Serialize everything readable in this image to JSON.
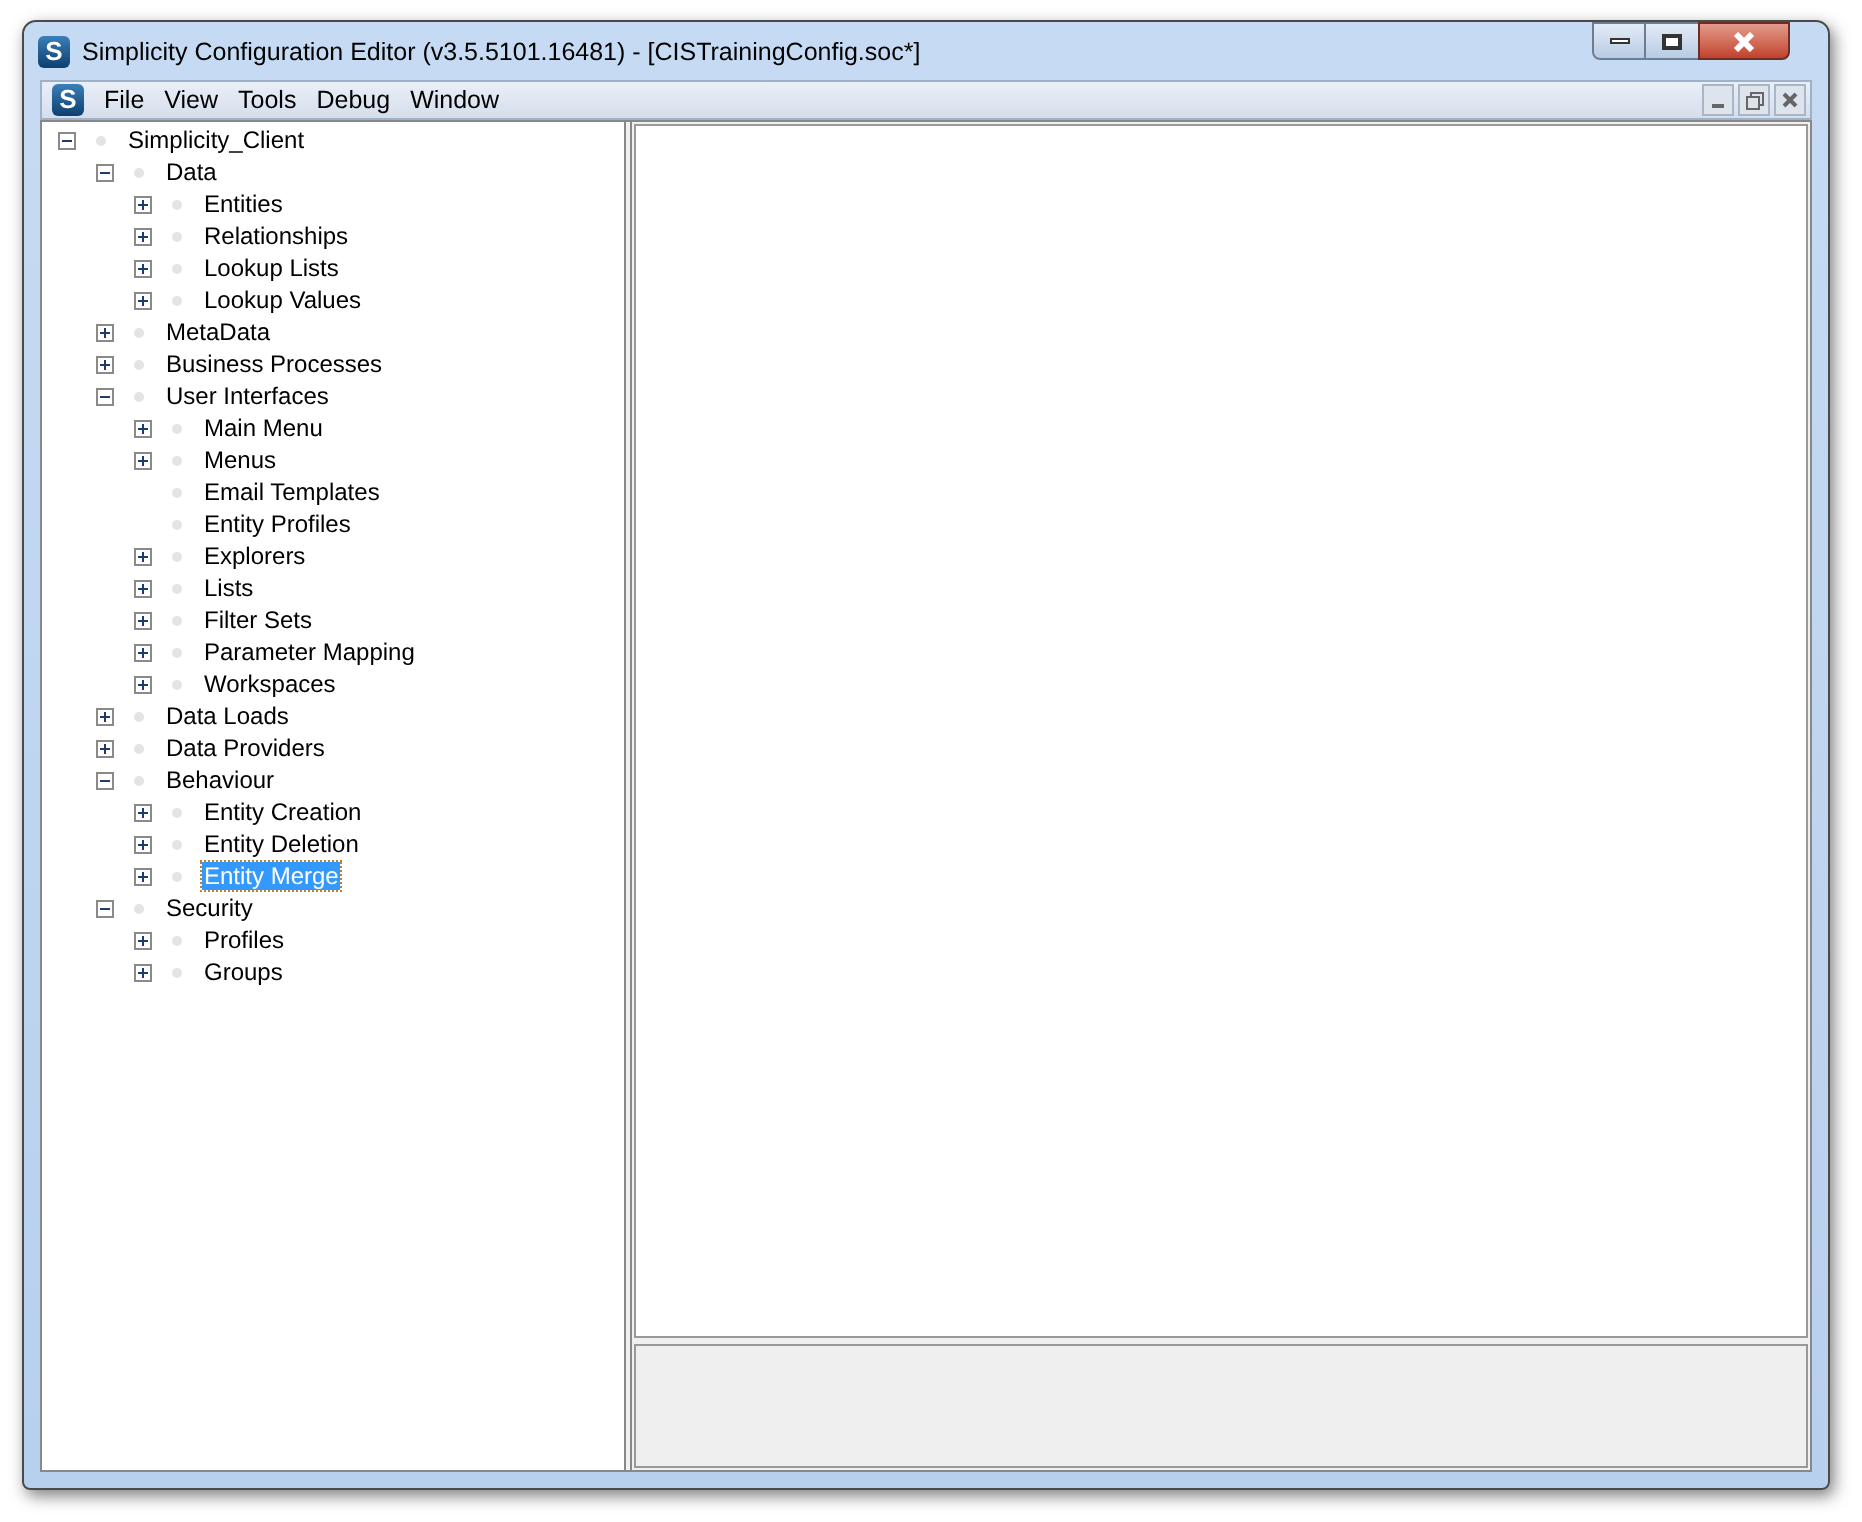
{
  "window": {
    "title": "Simplicity Configuration Editor (v3.5.5101.16481) - [CISTrainingConfig.soc*]",
    "app_icon": "S"
  },
  "menu_bar": {
    "icon": "S",
    "items": [
      "File",
      "View",
      "Tools",
      "Debug",
      "Window"
    ]
  },
  "tree": [
    {
      "label": "Simplicity_Client",
      "kind": "branch",
      "expanded": true,
      "selected": false,
      "children": [
        {
          "label": "Data",
          "kind": "branch",
          "expanded": true,
          "selected": false,
          "children": [
            {
              "label": "Entities",
              "kind": "branch",
              "expanded": false,
              "selected": false
            },
            {
              "label": "Relationships",
              "kind": "branch",
              "expanded": false,
              "selected": false
            },
            {
              "label": "Lookup Lists",
              "kind": "branch",
              "expanded": false,
              "selected": false
            },
            {
              "label": "Lookup Values",
              "kind": "branch",
              "expanded": false,
              "selected": false
            }
          ]
        },
        {
          "label": "MetaData",
          "kind": "branch",
          "expanded": false,
          "selected": false
        },
        {
          "label": "Business Processes",
          "kind": "branch",
          "expanded": false,
          "selected": false
        },
        {
          "label": "User Interfaces",
          "kind": "branch",
          "expanded": true,
          "selected": false,
          "children": [
            {
              "label": "Main Menu",
              "kind": "branch",
              "expanded": false,
              "selected": false
            },
            {
              "label": "Menus",
              "kind": "branch",
              "expanded": false,
              "selected": false
            },
            {
              "label": "Email Templates",
              "kind": "leaf",
              "selected": false
            },
            {
              "label": "Entity Profiles",
              "kind": "leaf",
              "selected": false
            },
            {
              "label": "Explorers",
              "kind": "branch",
              "expanded": false,
              "selected": false
            },
            {
              "label": "Lists",
              "kind": "branch",
              "expanded": false,
              "selected": false
            },
            {
              "label": "Filter Sets",
              "kind": "branch",
              "expanded": false,
              "selected": false
            },
            {
              "label": "Parameter Mapping",
              "kind": "branch",
              "expanded": false,
              "selected": false
            },
            {
              "label": "Workspaces",
              "kind": "branch",
              "expanded": false,
              "selected": false
            }
          ]
        },
        {
          "label": "Data Loads",
          "kind": "branch",
          "expanded": false,
          "selected": false
        },
        {
          "label": "Data Providers",
          "kind": "branch",
          "expanded": false,
          "selected": false
        },
        {
          "label": "Behaviour",
          "kind": "branch",
          "expanded": true,
          "selected": false,
          "children": [
            {
              "label": "Entity Creation",
              "kind": "branch",
              "expanded": false,
              "selected": false
            },
            {
              "label": "Entity Deletion",
              "kind": "branch",
              "expanded": false,
              "selected": false
            },
            {
              "label": "Entity Merge",
              "kind": "branch",
              "expanded": false,
              "selected": true
            }
          ]
        },
        {
          "label": "Security",
          "kind": "branch",
          "expanded": true,
          "selected": false,
          "children": [
            {
              "label": "Profiles",
              "kind": "branch",
              "expanded": false,
              "selected": false
            },
            {
              "label": "Groups",
              "kind": "branch",
              "expanded": false,
              "selected": false
            }
          ]
        }
      ]
    }
  ]
}
